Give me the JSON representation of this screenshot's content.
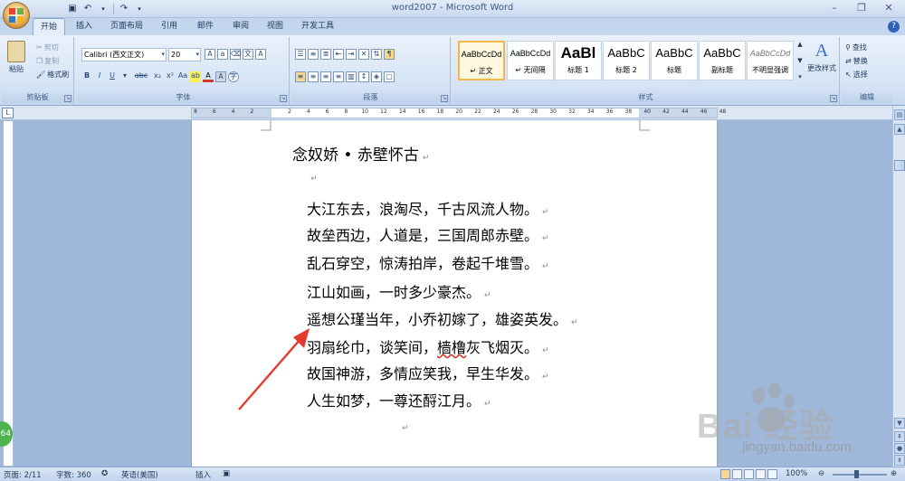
{
  "window": {
    "title": "word2007 - Microsoft Word"
  },
  "tabs": [
    "开始",
    "插入",
    "页面布局",
    "引用",
    "邮件",
    "审阅",
    "视图",
    "开发工具"
  ],
  "clipboard": {
    "paste": "粘贴",
    "cut": "剪切",
    "copy": "复制",
    "format_painter": "格式刷",
    "label": "剪贴板"
  },
  "font": {
    "name": "Calibri (西文正文)",
    "size": "20",
    "label": "字体"
  },
  "paragraph": {
    "label": "段落"
  },
  "styles": {
    "label": "样式",
    "items": [
      {
        "sample": "AaBbCcDd",
        "name": "↵ 正文"
      },
      {
        "sample": "AaBbCcDd",
        "name": "↵ 无间隔"
      },
      {
        "sample": "AaBl",
        "name": "标题 1"
      },
      {
        "sample": "AaBbC",
        "name": "标题 2"
      },
      {
        "sample": "AaBbC",
        "name": "标题"
      },
      {
        "sample": "AaBbC",
        "name": "副标题"
      },
      {
        "sample": "AaBbCcDd",
        "name": "不明显强调"
      }
    ],
    "change_styles": "更改样式"
  },
  "editing": {
    "find": "查找",
    "replace": "替换",
    "select": "选择",
    "label": "编辑"
  },
  "ruler": {
    "ticks": [
      "8",
      "6",
      "4",
      "2",
      "",
      "2",
      "4",
      "6",
      "8",
      "10",
      "12",
      "14",
      "16",
      "18",
      "20",
      "22",
      "24",
      "26",
      "28",
      "30",
      "32",
      "34",
      "36",
      "38",
      "40",
      "42",
      "44",
      "46",
      "48"
    ]
  },
  "document": {
    "title": "念奴娇 • 赤壁怀古",
    "lines": [
      "大江东去，浪淘尽，千古风流人物。",
      "故垒西边，人道是，三国周郎赤壁。",
      "乱石穿空，惊涛拍岸，卷起千堆雪。",
      "江山如画，一时多少豪杰。",
      "遥想公瑾当年，小乔初嫁了，雄姿英发。",
      "羽扇纶巾，谈笑间，",
      "故国神游，多情应笑我，早生华发。",
      "人生如梦，一尊还酹江月。"
    ],
    "line6_spell": "樯橹",
    "line6_end": "灰飞烟灭。",
    "para_mark": "↵"
  },
  "status": {
    "page": "页面: 2/11",
    "words": "字数: 360",
    "language": "英语(美国)",
    "mode": "插入",
    "zoom": "100%"
  },
  "watermark": {
    "brand": "Bai  经验",
    "url": "jingyan.baidu.com"
  },
  "badge": {
    "text": "64"
  },
  "colors": {
    "arrow": "#e53b2e",
    "accent": "#f2b94a"
  }
}
